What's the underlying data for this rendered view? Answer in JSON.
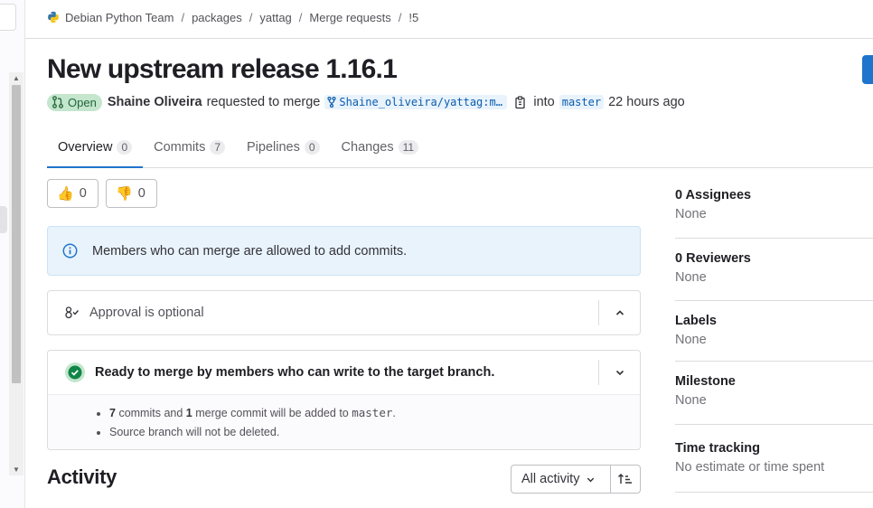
{
  "breadcrumb": {
    "items": [
      "Debian Python Team",
      "packages",
      "yattag",
      "Merge requests",
      "!5"
    ]
  },
  "merge_request": {
    "title": "New upstream release 1.16.1",
    "state": "Open",
    "author": "Shaine Oliveira",
    "action_text": "requested to merge",
    "source_branch": "Shaine_oliveira/yattag:master",
    "into_text": "into",
    "target_branch": "master",
    "time_ago": "22 hours ago"
  },
  "tabs": [
    {
      "label": "Overview",
      "count": "0",
      "active": true
    },
    {
      "label": "Commits",
      "count": "7",
      "active": false
    },
    {
      "label": "Pipelines",
      "count": "0",
      "active": false
    },
    {
      "label": "Changes",
      "count": "11",
      "active": false
    }
  ],
  "reactions": {
    "thumbs_up": {
      "emoji": "👍",
      "count": "0"
    },
    "thumbs_down": {
      "emoji": "👎",
      "count": "0"
    }
  },
  "info_alert": {
    "text": "Members who can merge are allowed to add commits."
  },
  "approval": {
    "text": "Approval is optional"
  },
  "merge_widget": {
    "status_text": "Ready to merge by members who can write to the target branch.",
    "commit_count": "7",
    "commits_text": "commits and",
    "merge_commit_count": "1",
    "merge_commit_text": "merge commit will be added to",
    "target_branch": "master",
    "source_branch_note": "Source branch will not be deleted."
  },
  "activity": {
    "heading": "Activity",
    "filter_label": "All activity"
  },
  "sidebar": {
    "assignees": {
      "title": "0 Assignees",
      "value": "None"
    },
    "reviewers": {
      "title": "0 Reviewers",
      "value": "None"
    },
    "labels": {
      "title": "Labels",
      "value": "None"
    },
    "milestone": {
      "title": "Milestone",
      "value": "None"
    },
    "time_tracking": {
      "title": "Time tracking",
      "value": "No estimate or time spent"
    }
  },
  "colors": {
    "accent": "#1f75cb",
    "open_badge_bg": "#c3e6cd",
    "open_badge_fg": "#24663b",
    "success": "#108548",
    "info_bg": "#e9f3fc"
  }
}
